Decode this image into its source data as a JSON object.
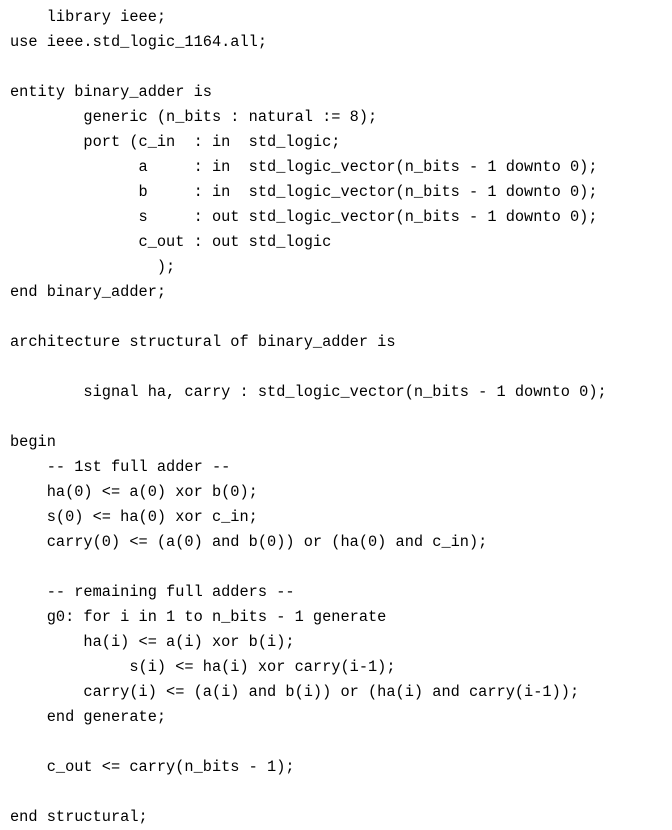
{
  "document": {
    "kind": "source-code-listing",
    "language": "VHDL",
    "entity_name": "binary_adder",
    "architecture_name": "structural",
    "background_color": "#ffffff",
    "text_color": "#000000",
    "font_kind": "monospace",
    "font_size_px": 15.3,
    "line_height_px": 25,
    "line_count": 25,
    "lines": [
      "    library ieee;",
      "use ieee.std_logic_1164.all;",
      "",
      "entity binary_adder is",
      "        generic (n_bits : natural := 8);",
      "        port (c_in  : in  std_logic;",
      "              a     : in  std_logic_vector(n_bits - 1 downto 0);",
      "              b     : in  std_logic_vector(n_bits - 1 downto 0);",
      "              s     : out std_logic_vector(n_bits - 1 downto 0);",
      "              c_out : out std_logic",
      "                );",
      "end binary_adder;",
      "",
      "architecture structural of binary_adder is",
      "",
      "        signal ha, carry : std_logic_vector(n_bits - 1 downto 0);",
      "",
      "begin",
      "    -- 1st full adder --",
      "    ha(0) <= a(0) xor b(0);",
      "    s(0) <= ha(0) xor c_in;",
      "    carry(0) <= (a(0) and b(0)) or (ha(0) and c_in);",
      "",
      "    -- remaining full adders --",
      "    g0: for i in 1 to n_bits - 1 generate",
      "        ha(i) <= a(i) xor b(i);",
      "             s(i) <= ha(i) xor carry(i-1);",
      "        carry(i) <= (a(i) and b(i)) or (ha(i) and carry(i-1));",
      "    end generate;",
      "",
      "    c_out <= carry(n_bits - 1);",
      "",
      "end structural;"
    ],
    "full_text": "    library ieee;\nuse ieee.std_logic_1164.all;\n\nentity binary_adder is\n        generic (n_bits : natural := 8);\n        port (c_in  : in  std_logic;\n              a     : in  std_logic_vector(n_bits - 1 downto 0);\n              b     : in  std_logic_vector(n_bits - 1 downto 0);\n              s     : out std_logic_vector(n_bits - 1 downto 0);\n              c_out : out std_logic\n                );\nend binary_adder;\n\narchitecture structural of binary_adder is\n\n        signal ha, carry : std_logic_vector(n_bits - 1 downto 0);\n\nbegin\n    -- 1st full adder --\n    ha(0) <= a(0) xor b(0);\n    s(0) <= ha(0) xor c_in;\n    carry(0) <= (a(0) and b(0)) or (ha(0) and c_in);\n\n    -- remaining full adders --\n    g0: for i in 1 to n_bits - 1 generate\n        ha(i) <= a(i) xor b(i);\n             s(i) <= ha(i) xor carry(i-1);\n        carry(i) <= (a(i) and b(i)) or (ha(i) and carry(i-1));\n    end generate;\n\n    c_out <= carry(n_bits - 1);\n\nend structural;",
    "comments": [
      "-- 1st full adder --",
      "-- remaining full adders --"
    ],
    "generics": [
      {
        "name": "n_bits",
        "type": "natural",
        "default": "8"
      }
    ],
    "ports": [
      {
        "name": "c_in",
        "direction": "in",
        "type": "std_logic"
      },
      {
        "name": "a",
        "direction": "in",
        "type": "std_logic_vector(n_bits - 1 downto 0)"
      },
      {
        "name": "b",
        "direction": "in",
        "type": "std_logic_vector(n_bits - 1 downto 0)"
      },
      {
        "name": "s",
        "direction": "out",
        "type": "std_logic_vector(n_bits - 1 downto 0)"
      },
      {
        "name": "c_out",
        "direction": "out",
        "type": "std_logic"
      }
    ],
    "signals": [
      {
        "name": "ha",
        "type": "std_logic_vector(n_bits - 1 downto 0)"
      },
      {
        "name": "carry",
        "type": "std_logic_vector(n_bits - 1 downto 0)"
      }
    ],
    "generate_label": "g0"
  }
}
